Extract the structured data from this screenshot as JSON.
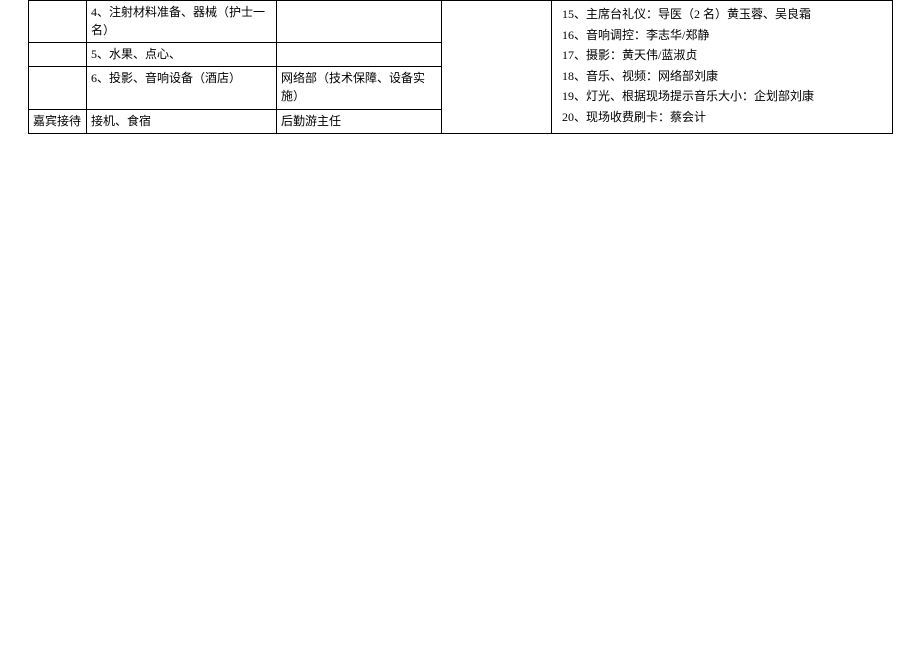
{
  "table": {
    "rows": [
      {
        "a": "",
        "b": "4、注射材料准备、器械（护士一名）",
        "c": ""
      },
      {
        "a": "",
        "b": "5、水果、点心、",
        "c": ""
      },
      {
        "a": "",
        "b": "6、投影、音响设备（酒店）",
        "c": "网络部（技术保障、设备实施）"
      },
      {
        "a": "嘉宾接待",
        "b": "接机、食宿",
        "c": "后勤游主任"
      }
    ],
    "d_merged": "",
    "e_items": [
      "15、主席台礼仪：导医（2 名）黄玉蓉、吴良霜",
      "16、音响调控：李志华/郑静",
      "17、摄影：黄天伟/蓝淑贞",
      "18、音乐、视频：网络部刘康",
      "19、灯光、根据现场提示音乐大小：企划部刘康",
      "20、现场收费刷卡：蔡会计"
    ]
  }
}
